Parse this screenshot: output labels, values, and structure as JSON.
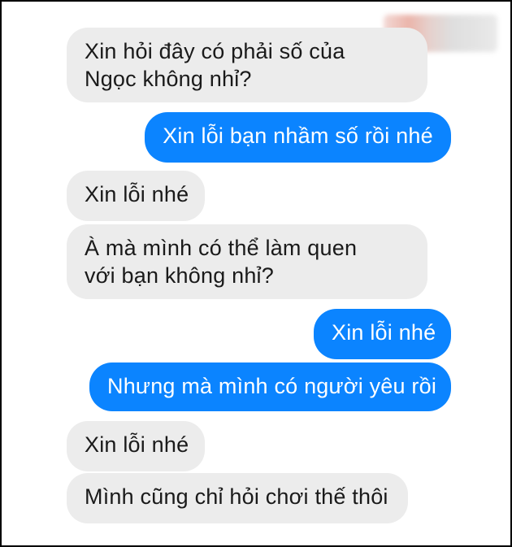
{
  "conversation": {
    "messages": [
      {
        "sender": "other",
        "lines": [
          "Xin hỏi đây có phải số của",
          "Ngọc không nhỉ?"
        ]
      },
      {
        "sender": "me",
        "lines": [
          "Xin lỗi bạn nhầm số rồi nhé"
        ]
      },
      {
        "sender": "other",
        "lines": [
          "Xin lỗi nhé"
        ]
      },
      {
        "sender": "other",
        "lines": [
          "À mà mình có thể làm quen",
          "với bạn không nhỉ?"
        ]
      },
      {
        "sender": "me",
        "lines": [
          "Xin lỗi nhé"
        ]
      },
      {
        "sender": "me",
        "lines": [
          "Nhưng mà mình có người yêu rồi"
        ]
      },
      {
        "sender": "other",
        "lines": [
          "Xin lỗi nhé"
        ]
      },
      {
        "sender": "other",
        "lines": [
          "Mình cũng chỉ hỏi chơi thế thôi"
        ]
      }
    ]
  },
  "colors": {
    "incoming_bubble": "#ececec",
    "outgoing_bubble": "#0b84ff",
    "outgoing_text": "#ffffff",
    "incoming_text": "#1a1a1a"
  }
}
